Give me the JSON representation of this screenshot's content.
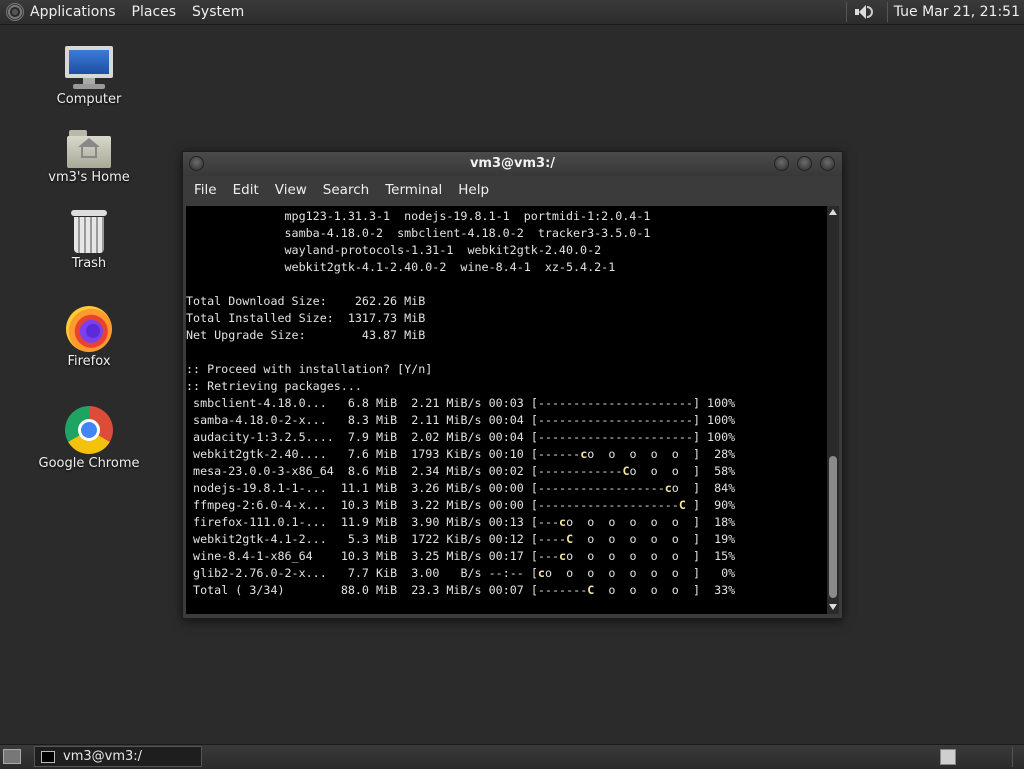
{
  "top_panel": {
    "menus": [
      "Applications",
      "Places",
      "System"
    ],
    "clock": "Tue Mar 21, 21:51"
  },
  "desktop_icons": [
    {
      "label": "Computer",
      "icon": "computer-icon"
    },
    {
      "label": "vm3's Home",
      "icon": "home-folder-icon"
    },
    {
      "label": "Trash",
      "icon": "trash-icon"
    },
    {
      "label": "Firefox",
      "icon": "firefox-icon"
    },
    {
      "label": "Google Chrome",
      "icon": "chrome-icon"
    }
  ],
  "terminal": {
    "title": "vm3@vm3:/",
    "menus": [
      "File",
      "Edit",
      "View",
      "Search",
      "Terminal",
      "Help"
    ],
    "package_lines": [
      "              mpg123-1.31.3-1  nodejs-19.8.1-1  portmidi-1:2.0.4-1",
      "              samba-4.18.0-2  smbclient-4.18.0-2  tracker3-3.5.0-1",
      "              wayland-protocols-1.31-1  webkit2gtk-2.40.0-2",
      "              webkit2gtk-4.1-2.40.0-2  wine-8.4-1  xz-5.4.2-1"
    ],
    "totals": [
      "Total Download Size:    262.26 MiB",
      "Total Installed Size:  1317.73 MiB",
      "Net Upgrade Size:        43.87 MiB"
    ],
    "prompts": [
      ":: Proceed with installation? [Y/n]",
      ":: Retrieving packages..."
    ],
    "downloads": [
      {
        "name": "smbclient-4.18.0...",
        "size": "6.8 MiB",
        "rate": "2.21 MiB/s",
        "eta": "00:03",
        "bar": "[----------------------]",
        "pct": "100%"
      },
      {
        "name": "samba-4.18.0-2-x...",
        "size": "8.3 MiB",
        "rate": "2.11 MiB/s",
        "eta": "00:04",
        "bar": "[----------------------]",
        "pct": "100%"
      },
      {
        "name": "audacity-1:3.2.5....",
        "size": "7.9 MiB",
        "rate": "2.02 MiB/s",
        "eta": "00:04",
        "bar": "[----------------------]",
        "pct": "100%"
      },
      {
        "name": "webkit2gtk-2.40....",
        "size": "7.6 MiB",
        "rate": "1793 KiB/s",
        "eta": "00:10",
        "bar": "[------co  o  o  o  o  ]",
        "pct": "28%"
      },
      {
        "name": "mesa-23.0.0-3-x86_64",
        "size": "8.6 MiB",
        "rate": "2.34 MiB/s",
        "eta": "00:02",
        "bar": "[------------Co  o  o  ]",
        "pct": "58%"
      },
      {
        "name": "nodejs-19.8.1-1-...",
        "size": "11.1 MiB",
        "rate": "3.26 MiB/s",
        "eta": "00:00",
        "bar": "[------------------co  ]",
        "pct": "84%"
      },
      {
        "name": "ffmpeg-2:6.0-4-x...",
        "size": "10.3 MiB",
        "rate": "3.22 MiB/s",
        "eta": "00:00",
        "bar": "[--------------------C ]",
        "pct": "90%"
      },
      {
        "name": "firefox-111.0.1-...",
        "size": "11.9 MiB",
        "rate": "3.90 MiB/s",
        "eta": "00:13",
        "bar": "[---co  o  o  o  o  o  ]",
        "pct": "18%"
      },
      {
        "name": "webkit2gtk-4.1-2...",
        "size": "5.3 MiB",
        "rate": "1722 KiB/s",
        "eta": "00:12",
        "bar": "[----C  o  o  o  o  o  ]",
        "pct": "19%"
      },
      {
        "name": "wine-8.4-1-x86_64",
        "size": "10.3 MiB",
        "rate": "3.25 MiB/s",
        "eta": "00:17",
        "bar": "[---co  o  o  o  o  o  ]",
        "pct": "15%"
      },
      {
        "name": "glib2-2.76.0-2-x...",
        "size": "7.7 KiB",
        "rate": "3.00   B/s",
        "eta": "--:--",
        "bar": "[co  o  o  o  o  o  o  ]",
        "pct": "0%"
      },
      {
        "name": "Total ( 3/34)",
        "size": "88.0 MiB",
        "rate": "23.3 MiB/s",
        "eta": "00:07",
        "bar": "[-------C  o  o  o  o  ]",
        "pct": "33%"
      }
    ]
  },
  "taskbar": {
    "task_label": "vm3@vm3:/"
  }
}
